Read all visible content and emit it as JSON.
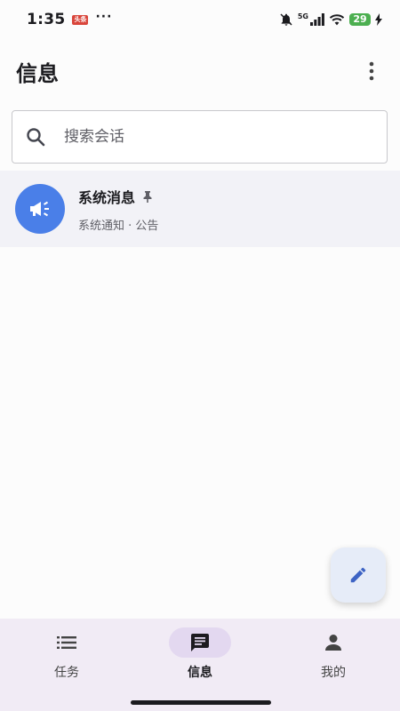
{
  "status_bar": {
    "time": "1:35",
    "badge": "头条",
    "dots": "···",
    "network": "5G",
    "battery": "29"
  },
  "header": {
    "title": "信息"
  },
  "search": {
    "placeholder": "搜索会话",
    "value": ""
  },
  "conversations": [
    {
      "title": "系统消息",
      "subtitle": "系统通知 · 公告",
      "pinned": true,
      "avatar_icon": "megaphone-icon",
      "avatar_color": "#4a7fe8"
    }
  ],
  "fab": {
    "icon": "pencil-icon"
  },
  "bottom_nav": {
    "items": [
      {
        "label": "任务",
        "icon": "list-icon",
        "active": false
      },
      {
        "label": "信息",
        "icon": "message-icon",
        "active": true
      },
      {
        "label": "我的",
        "icon": "person-icon",
        "active": false
      }
    ]
  },
  "colors": {
    "accent": "#4a7fe8",
    "nav_background": "#f1ebf5",
    "nav_active_pill": "#e3d8f0",
    "battery": "#4caf50"
  }
}
